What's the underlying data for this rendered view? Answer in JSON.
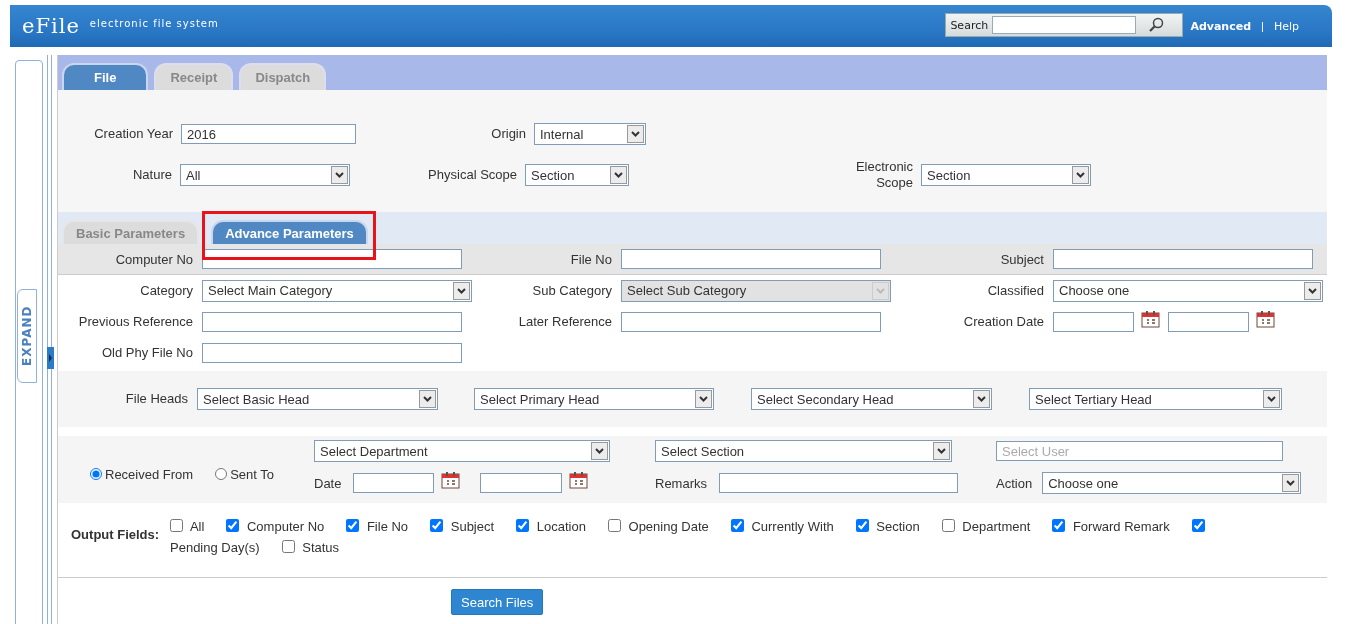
{
  "header": {
    "logo": "eFile",
    "tagline": "electronic file system",
    "search_label": "Search",
    "links": [
      "Advanced",
      "Help"
    ],
    "separator": "|"
  },
  "sidebar": {
    "expand_label": "EXPAND"
  },
  "tabs": [
    {
      "label": "File",
      "selected": true
    },
    {
      "label": "Receipt",
      "selected": false
    },
    {
      "label": "Dispatch",
      "selected": false
    }
  ],
  "filters": [
    {
      "label": "Creation Year",
      "kind": "text",
      "value": "2016"
    },
    {
      "label": "Origin",
      "kind": "select",
      "value": "Internal"
    },
    {
      "label": "Nature",
      "kind": "select",
      "value": "All"
    },
    {
      "label": "Physical Scope",
      "kind": "select",
      "value": "Section"
    },
    {
      "label": "Electronic Scope",
      "kind": "select",
      "value": "Section"
    }
  ],
  "parameter_tabs": [
    {
      "label": "Basic Parameters",
      "selected": false,
      "highlighted": false
    },
    {
      "label": "Advance Parameters",
      "selected": true,
      "highlighted": true
    }
  ],
  "id_fields": [
    {
      "label": "Computer No",
      "kind": "text"
    },
    {
      "label": "File No",
      "kind": "text"
    },
    {
      "label": "Subject",
      "kind": "text"
    }
  ],
  "detail_fields": [
    {
      "label": "Category",
      "kind": "select",
      "value": "Select Main Category",
      "disabled": false
    },
    {
      "label": "Sub Category",
      "kind": "select",
      "value": "Select Sub Category",
      "disabled": true
    },
    {
      "label": "Classified",
      "kind": "select",
      "value": "Choose one",
      "disabled": false
    },
    {
      "label": "Previous Reference",
      "kind": "text"
    },
    {
      "label": "Later Reference",
      "kind": "text"
    },
    {
      "label": "Creation Date",
      "kind": "daterange"
    },
    {
      "label": "Old Phy File No",
      "kind": "text"
    }
  ],
  "file_heads": {
    "label": "File Heads",
    "selects": [
      "Select Basic Head",
      "Select Primary Head",
      "Select Secondary Head",
      "Select Tertiary Head"
    ]
  },
  "movement": {
    "options": [
      {
        "label": "Received From",
        "selected": true
      },
      {
        "label": "Sent To",
        "selected": false
      }
    ],
    "department": "Select Department",
    "section": "Select Section",
    "user_placeholder": "Select User",
    "date_label": "Date",
    "remarks_label": "Remarks",
    "action_label": "Action",
    "action": "Choose one"
  },
  "output_fields": {
    "label": "Output Fields:",
    "items": [
      {
        "label": "All",
        "checked": false
      },
      {
        "label": "Computer No",
        "checked": true
      },
      {
        "label": "File No",
        "checked": true
      },
      {
        "label": "Subject",
        "checked": true
      },
      {
        "label": "Location",
        "checked": true
      },
      {
        "label": "Opening Date",
        "checked": false
      },
      {
        "label": "Currently With",
        "checked": true
      },
      {
        "label": "Section",
        "checked": true
      },
      {
        "label": "Department",
        "checked": false
      },
      {
        "label": "Forward Remark",
        "checked": true
      },
      {
        "label": "Pending Day(s)",
        "checked": true
      },
      {
        "label": "Status",
        "checked": false
      }
    ]
  },
  "search_button": "Search Files"
}
